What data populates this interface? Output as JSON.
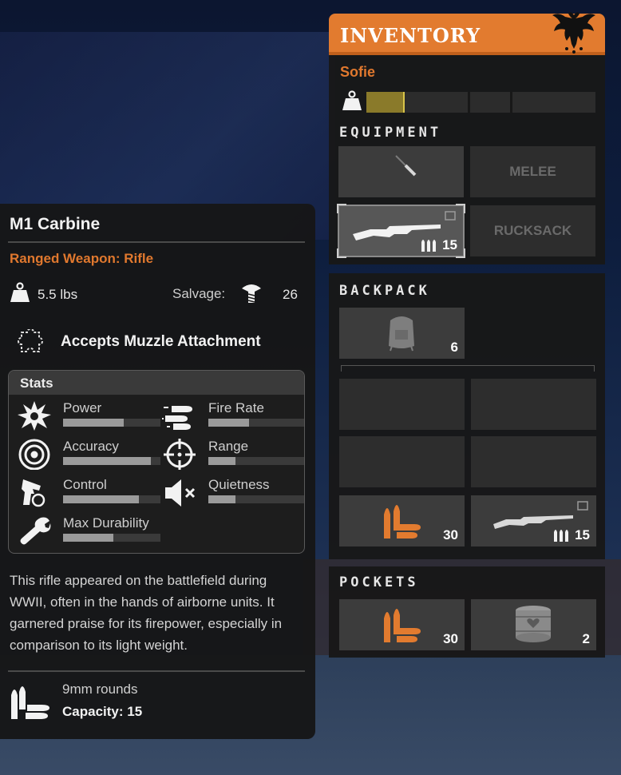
{
  "item_detail": {
    "name": "M1 Carbine",
    "category": "Ranged Weapon: Rifle",
    "weight": "5.5 lbs",
    "salvage_label": "Salvage:",
    "salvage_value": "26",
    "attachment": "Accepts Muzzle Attachment",
    "stats_title": "Stats",
    "stats": [
      {
        "label": "Power",
        "icon": "explosion-icon",
        "level": 0.62
      },
      {
        "label": "Fire Rate",
        "icon": "bullets-icon",
        "level": 0.42
      },
      {
        "label": "Accuracy",
        "icon": "target-icon",
        "level": 0.9
      },
      {
        "label": "Range",
        "icon": "crosshair-icon",
        "level": 0.28
      },
      {
        "label": "Control",
        "icon": "pistol-icon",
        "level": 0.78
      },
      {
        "label": "Quietness",
        "icon": "muted-speaker-icon",
        "level": 0.28
      },
      {
        "label": "Max Durability",
        "icon": "wrench-icon",
        "level": 0.52
      }
    ],
    "description": "This rifle appeared on the battlefield during WWII, often in the hands of airborne units. It garnered praise for its firepower, especially in comparison to its light weight.",
    "ammo_type": "9mm rounds",
    "capacity": "Capacity: 15"
  },
  "inventory": {
    "title": "INVENTORY",
    "character": "Sofie",
    "capacity_fill": 0.16,
    "equipment_title": "EQUIPMENT",
    "equipment": {
      "melee_slot_item": "screwdriver-icon",
      "melee_label": "MELEE",
      "ranged_ammo": "15",
      "rucksack_label": "RUCKSACK"
    },
    "backpack_title": "BACKPACK",
    "backpack": {
      "pack_count": "6",
      "ammo_count": "30",
      "rifle_ammo": "15"
    },
    "pockets_title": "POCKETS",
    "pockets": {
      "ammo_count": "30",
      "can_count": "2"
    }
  },
  "colors": {
    "accent": "#e0782e",
    "header": "#e27b2f"
  }
}
